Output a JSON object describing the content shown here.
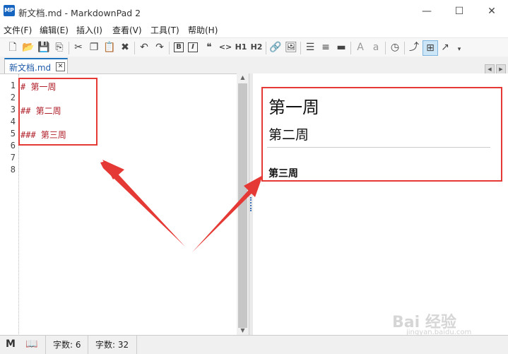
{
  "window": {
    "icon_text": "MP",
    "title": "新文档.md - MarkdownPad 2",
    "minimize_glyph": "—",
    "maximize_glyph": "☐",
    "close_glyph": "✕"
  },
  "menu": [
    "文件(F)",
    "编辑(E)",
    "插入(I)",
    "查看(V)",
    "工具(T)",
    "帮助(H)"
  ],
  "toolbar": {
    "buttons": [
      {
        "name": "new-document-icon",
        "glyph": "🗋"
      },
      {
        "name": "open-folder-icon",
        "glyph": "📂"
      },
      {
        "name": "save-icon",
        "glyph": "💾"
      },
      {
        "name": "save-all-icon",
        "glyph": "⎘"
      },
      {
        "name": "cut-icon",
        "glyph": "✂"
      },
      {
        "name": "copy-icon",
        "glyph": "❐"
      },
      {
        "name": "paste-icon",
        "glyph": "📋"
      },
      {
        "name": "delete-icon",
        "glyph": "✖"
      },
      {
        "name": "undo-icon",
        "glyph": "↶"
      },
      {
        "name": "redo-icon",
        "glyph": "↷"
      },
      {
        "name": "bold-icon",
        "glyph": "B"
      },
      {
        "name": "italic-icon",
        "glyph": "I"
      },
      {
        "name": "quote-icon",
        "glyph": "❝"
      },
      {
        "name": "code-icon",
        "glyph": "<>"
      },
      {
        "name": "heading1-icon",
        "glyph": "H1"
      },
      {
        "name": "heading2-icon",
        "glyph": "H2"
      },
      {
        "name": "link-icon",
        "glyph": "🔗"
      },
      {
        "name": "image-icon",
        "glyph": "🖼"
      },
      {
        "name": "bulleted-list-icon",
        "glyph": "☰"
      },
      {
        "name": "numbered-list-icon",
        "glyph": "≡"
      },
      {
        "name": "horizontal-rule-icon",
        "glyph": "▬"
      },
      {
        "name": "uppercase-icon",
        "glyph": "A"
      },
      {
        "name": "lowercase-icon",
        "glyph": "a"
      },
      {
        "name": "timestamp-icon",
        "glyph": "◷"
      },
      {
        "name": "swap-panes-icon",
        "glyph": "⤴"
      },
      {
        "name": "live-preview-icon",
        "glyph": "⊞"
      },
      {
        "name": "export-icon",
        "glyph": "↗"
      },
      {
        "name": "toolbar-overflow-icon",
        "glyph": "▾"
      }
    ]
  },
  "tab": {
    "label": "新文档.md",
    "close_glyph": "✕"
  },
  "tab_nav": {
    "left": "◀",
    "right": "▶"
  },
  "editor": {
    "line_numbers": [
      "1",
      "2",
      "3",
      "4",
      "5",
      "6",
      "7",
      "8"
    ],
    "lines": [
      "# 第一周",
      "",
      "## 第二周",
      "",
      "### 第三周",
      "",
      "",
      ""
    ]
  },
  "preview": {
    "h1": "第一周",
    "h2": "第二周",
    "h3": "第三周"
  },
  "status": {
    "markdown_icon": "M",
    "book_icon": "📖",
    "word_count": "字数: 6",
    "char_count": "字数: 32"
  },
  "watermark": {
    "text": "Bai 经验",
    "url": "jingyan.baidu.com"
  },
  "colors": {
    "annotation": "#e53935",
    "code_text": "#b0202a",
    "tab_accent": "#1e73be"
  }
}
